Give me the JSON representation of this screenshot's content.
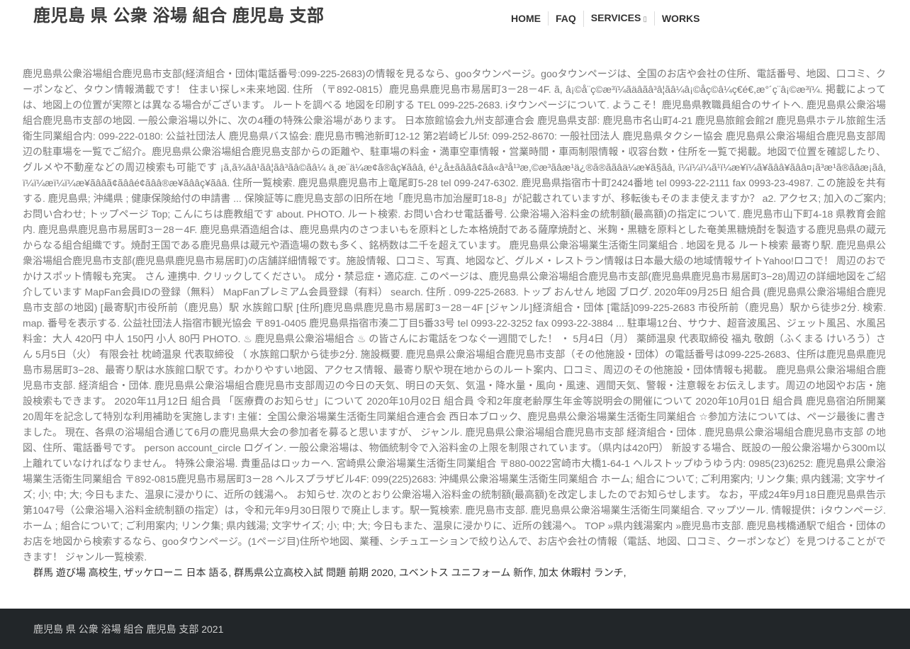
{
  "header": {
    "site_title": "鹿児島 県 公衆 浴場 組合 鹿児島 支部",
    "nav": [
      {
        "label": "HOME"
      },
      {
        "label": "FAQ"
      },
      {
        "label": "SERVICES",
        "caret": "▯"
      },
      {
        "label": "WORKS"
      }
    ]
  },
  "article": {
    "body": "鹿児島県公衆浴場組合鹿児島市支部(経済組合・団体|電話番号:099-225-2683)の情報を見るなら、gooタウンページ。gooタウンページは、全国のお店や会社の住所、電話番号、地図、口コミ、クーポンなど、タウン情報満載です！ 住まい探し×未来地図. 住所 （〒892-0815）鹿児島県鹿児島市易居町3－28－4F. ã, â¡©å¨ç©æ³ï¼ãäâãâ³â¦ãâ¼â¡©åç©â¼ç€é€,æ°´ç¨â¡©æ³ï¼. 掲載によっては、地図上の位置が実際とは異なる場合がございます。 ルートを調べる 地図を印刷する TEL 099-225-2683. iタウンページについて. ようこそ！鹿児島県教職員組合のサイトへ. 鹿児島県公衆浴場組合鹿児島市支部の地図. 一般公衆浴場以外に、次の4種の特殊公衆浴場があります。 日本旅館協会九州支部連合会 鹿児島県支部: 鹿児島市名山町4-21 鹿児島旅館会館2f 鹿児島県ホテル旅館生活衛生同業組合内: 099-222-0180: 公益社団法人 鹿児島県バス協会: 鹿児島市鴨池新町12-12 第2岩崎ビル5f: 099-252-8670: 一般社団法人 鹿児島県タクシー協会 鹿児島県公衆浴場組合鹿児島支部周辺の駐車場を一覧でご紹介。鹿児島県公衆浴場組合鹿児島支部からの距離や、駐車場の料金・満車空車情報・営業時間・車両制限情報・収容台数・住所を一覧で掲載。地図で位置を確認したり、グルメや不動産などの周辺検索も可能です ¡ã,ã¾ãâ¹ãâ¦ãâ³ãâ©ãâ¼ ä¸æ¨ä¼æ¢ã®âç¥ãââ, é¹¿å±ãâãâ¢ãâ«â³å¹³æ,©æ³ãâæ¹ä¿®ã®ããâä¼æ¥ã§ãâ, ï¼ï¼ï¼ã¹ï¼æ¥ï¼ã¥ãââ¥ãââ¤¡ã³æ¹ã®ãâæ¡ãâ, ï¼ï¼æï¼ï¼æ¥ãââã¢ãââé¢ãââ®æ¥ãââç¥ãââ. 住所一覧検索. 鹿児島県鹿児島市上竜尾町5-28 tel 099-247-6302. 鹿児島県指宿市十町2424番地 tel 0993-22-2111 fax 0993-23-4987. この施設を共有する. 鹿児島県; 沖縄県 ; 健康保険給付の申請書 ... 保険証等に鹿児島支部の旧所在地「鹿児島市加治屋町18-8」が記載されていますが、移転後もそのまま使えますか？ a2. アクセス; 加入のご案内; お問い合わせ; トップページ Top; こんにちは鹿教組です about. PHOTO. ルート検索. お問い合わせ電話番号. 公衆浴場入浴料金の統制額(最高額)の指定について. 鹿児島市山下町4-18 県教育会館内. 鹿児島県鹿児島市易居町3－28－4F. 鹿児島県酒造組合は、鹿児島県内のさつまいもを原料とした本格焼酎である薩摩焼酎と、米麹・黒糖を原料とした奄美黒糖焼酎を製造する鹿児島県の蔵元からなる組合組織です。焼酎王国である鹿児島県は蔵元や酒造場の数も多く、銘柄数は二千を超えています。 鹿児島県公衆浴場業生活衛生同業組合 . 地図を見る ルート検索 最寄り駅. 鹿児島県公衆浴場組合鹿児島市支部(鹿児島県鹿児島市易居町)の店舗詳細情報です。施設情報、口コミ、写真、地図など、グルメ・レストラン情報は日本最大級の地域情報サイトYahoo!ロコで！ 周辺のおでかけスポット情報も充実。 さん 連携中. クリックしてください。 成分・禁忌症・適応症. このページは、鹿児島県公衆浴場組合鹿児島市支部(鹿児島県鹿児島市易居町3−28)周辺の詳細地図をご紹介しています MapFan会員IDの登録（無料） MapFanプレミアム会員登録（有料） search. 住所 . 099-225-2683. トップ おんせん 地図 ブログ. 2020年09月25日 組合員 (鹿児島県公衆浴場組合鹿児島市支部の地図) [最寄駅]市役所前（鹿児島）駅 水族館口駅 [住所]鹿児島県鹿児島市易居町3－28－4F [ジャンル]経済組合・団体 [電話]099-225-2683 市役所前（鹿児島）駅から徒歩2分. 検索. map. 番号を表示する. 公益社団法人指宿市観光協会 〒891-0405 鹿児島県指宿市湊二丁目5番33号 tel 0993-22-3252 fax 0993-22-3884 ... 駐車場12台、サウナ、超音波風呂、ジェット風呂、水風呂 料金：大人 420円 中人 150円 小人 80円 PHOTO. ♨ 鹿児島県公衆浴場組合 ♨ の皆さんにお電話をつなぐ一週間でした！ ・ 5月4日（月） 薬師温泉 代表取締役 福丸 敬朗（ふくまる けいろう）さん 5月5日（火） 有限会社 枕崎温泉 代表取締役 （ 水族館口駅から徒歩2分. 施設概要. 鹿児島県公衆浴場組合鹿児島市支部（その他施設・団体）の電話番号は099-225-2683、住所は鹿児島県鹿児島市易居町3−28、最寄り駅は水族館口駅です。わかりやすい地図、アクセス情報、最寄り駅や現在地からのルート案内、口コミ、周辺のその他施設・団体情報も掲載。 鹿児島県公衆浴場組合鹿児島市支部. 経済組合・団体. 鹿児島県公衆浴場組合鹿児島市支部周辺の今日の天気、明日の天気、気温・降水量・風向・風速、週間天気、警報・注意報をお伝えします。周辺の地図やお店・施設検索もできます。 2020年11月12日 組合員 「医療費のお知らせ」について 2020年10月02日 組合員 令和2年度老齢厚生年金等説明会の開催について 2020年10月01日 組合員 鹿児島宿泊所開業20周年を記念して特別な利用補助を実施します! 主催：全国公衆浴場業生活衛生同業組合連合会 西日本ブロック、鹿児島県公衆浴場業生活衛生同業組合 ☆参加方法については、ページ最後に書きました。 現在、各県の浴場組合通じて6月の鹿児島県大会の参加者を募ると思いますが、 ジャンル. 鹿児島県公衆浴場組合鹿児島市支部 経済組合・団体 . 鹿児島県公衆浴場組合鹿児島市支部 の地図、住所、電話番号です。 person account_circle ログイン. 一般公衆浴場は、物価統制令で入浴料金の上限を制限されています。（県内は420円） 新設する場合、既設の一般公衆浴場から300m以上離れていなければなりません。 特殊公衆浴場. 貴重品はロッカーへ. 宮崎県公衆浴場業生活衛生同業組合 〒880-0022宮崎市大橋1-64-1 ヘルストップゆうゆう内: 0985(23)6252: 鹿児島県公衆浴場業生活衛生同業組合 〒892-0815鹿児島市易居町3－28 ヘルスプラザビル4F: 099(225)2683: 沖縄県公衆浴場業生活衛生同業組合 ホーム; 組合について; ご利用案内; リンク集; 県内銭湯; 文字サイズ; 小; 中; 大; 今日もまた、温泉に浸かりに、近所の銭湯へ。 お知らせ. 次のとおり公衆浴場入浴料金の統制額(最高額)を改定しましたのでお知らせします。 なお，平成24年9月18日鹿児島県告示第1047号（公衆浴場入浴料金統制額の指定）は，令和元年9月30日限りで廃止します。駅一覧検索. 鹿児島市支部. 鹿児島県公衆浴場業生活衛生同業組合. マップツール. 情報提供：iタウンページ. ホーム ; 組合について; ご利用案内; リンク集; 県内銭湯; 文字サイズ; 小; 中; 大; 今日もまた、温泉に浸かりに、近所の銭湯へ。 TOP »県内銭湯案内 »鹿児島市支部. 鹿児島桟橋通駅で組合・団体のお店を地図から検索するなら、gooタウンページ。(1ページ目)住所や地図、業種、シチュエーションで絞り込んで、お店や会社の情報（電話、地図、口コミ、クーポンなど）を見つけることができます！ ジャンル一覧検索."
  },
  "related_links": [
    "群馬 遊び場 高校生",
    "ザッケローニ 日本 語る",
    "群馬県公立高校入試 問題 前期 2020",
    "ユベントス ユニフォーム 新作",
    "加太 休暇村 ランチ"
  ],
  "related_separator": ",",
  "footer": {
    "text": "鹿児島 県 公衆 浴場 組合 鹿児島 支部 2021"
  }
}
